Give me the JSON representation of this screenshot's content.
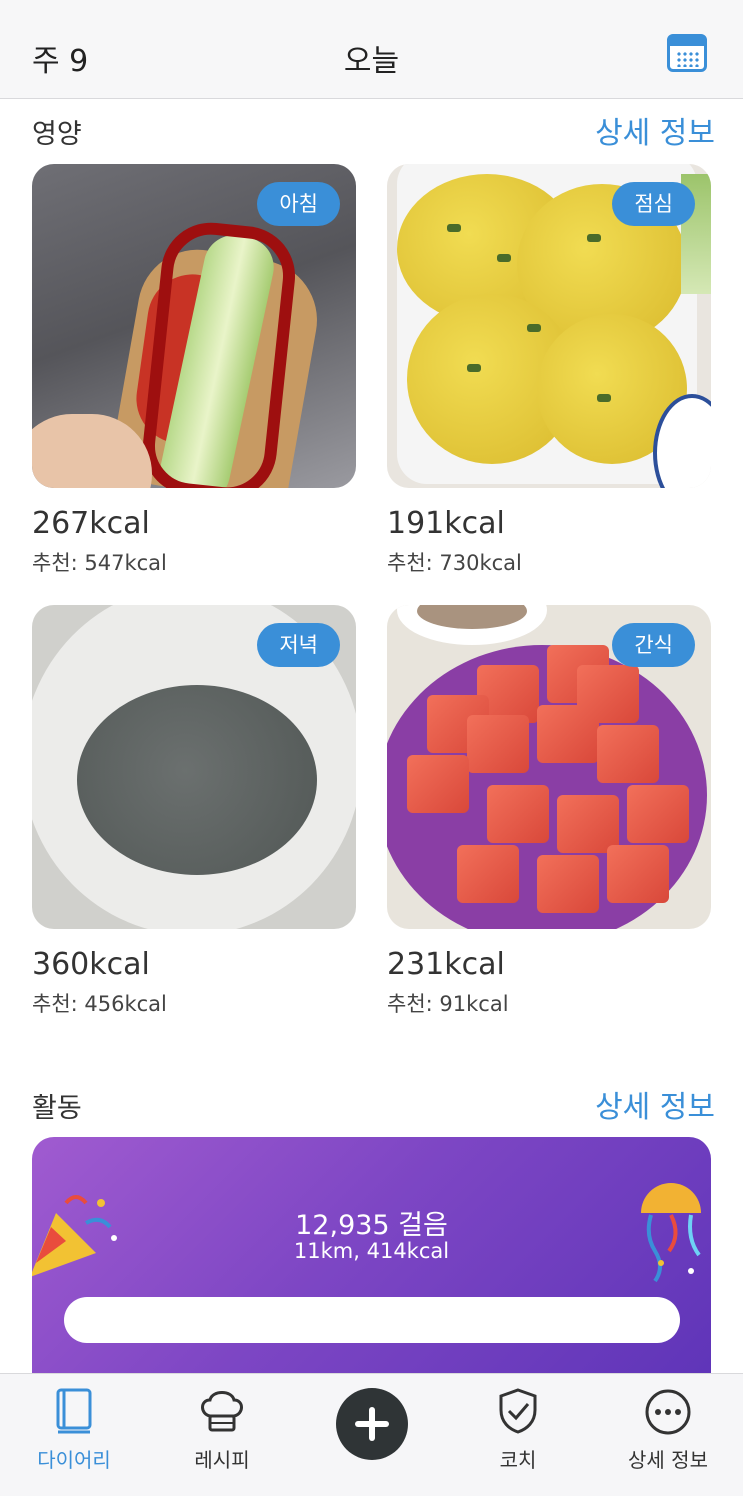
{
  "header": {
    "week": "주 9",
    "title": "오늘"
  },
  "nutrition": {
    "title": "영양",
    "detail_link": "상세 정보",
    "meals": [
      {
        "badge": "아침",
        "kcal": "267kcal",
        "recommended": "추천: 547kcal"
      },
      {
        "badge": "점심",
        "kcal": "191kcal",
        "recommended": "추천: 730kcal"
      },
      {
        "badge": "저녁",
        "kcal": "360kcal",
        "recommended": "추천: 456kcal"
      },
      {
        "badge": "간식",
        "kcal": "231kcal",
        "recommended": "추천: 91kcal"
      }
    ]
  },
  "activity": {
    "title": "활동",
    "detail_link": "상세 정보",
    "steps": "12,935 걸음",
    "summary": "11km, 414kcal"
  },
  "tabbar": {
    "items": [
      {
        "label": "다이어리",
        "icon": "book-icon"
      },
      {
        "label": "레시피",
        "icon": "chef-hat-icon"
      },
      {
        "label": "코치",
        "icon": "shield-check-icon"
      },
      {
        "label": "상세 정보",
        "icon": "more-icon"
      }
    ],
    "add_icon": "plus-icon",
    "active_color": "#3a8fd8"
  },
  "colors": {
    "accent": "#3a8fd8",
    "activity_gradient_start": "#a05bd0",
    "activity_gradient_end": "#5e34b8"
  }
}
